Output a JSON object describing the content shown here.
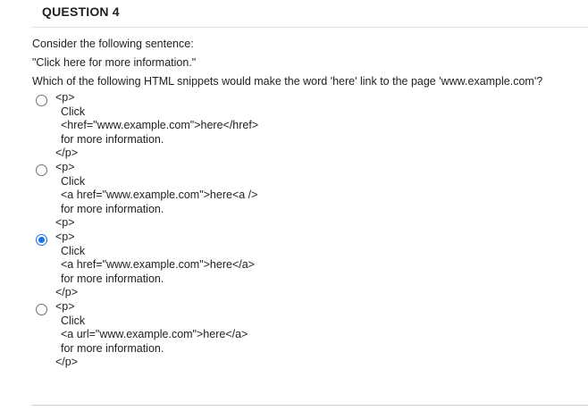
{
  "question": {
    "header": "QUESTION 4",
    "prompt": "Consider the following sentence:",
    "sentence": "\"Click here for more information.\"",
    "ask": "Which of the following HTML snippets would make the word 'here' link to the page 'www.example.com'?"
  },
  "options": [
    {
      "selected": false,
      "lines": [
        "<p>",
        "Click",
        "<href=\"www.example.com\">here</href>",
        "for more information.",
        "</p>"
      ]
    },
    {
      "selected": false,
      "lines": [
        "<p>",
        "Click",
        "<a href=\"www.example.com\">here<a />",
        "for more information.",
        "<p>"
      ]
    },
    {
      "selected": true,
      "lines": [
        "<p>",
        "Click",
        "<a href=\"www.example.com\">here</a>",
        "for more information.",
        "</p>"
      ]
    },
    {
      "selected": false,
      "lines": [
        "<p>",
        "Click",
        "<a url=\"www.example.com\">here</a>",
        "for more information.",
        "</p>"
      ]
    }
  ],
  "colors": {
    "accent": "#1a73e8",
    "text": "#222222",
    "divider": "#e4e4e4"
  }
}
